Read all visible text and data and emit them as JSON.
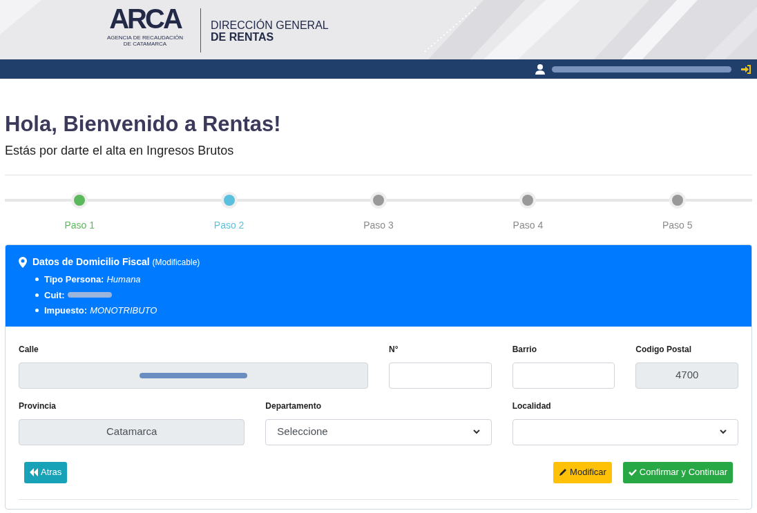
{
  "banner": {
    "logo": "ARCA",
    "agency_lines": [
      "AGENCIA DE RECAUDACIÓN",
      "DE CATAMARCA"
    ],
    "title_lines": [
      "DIRECCIÓN GENERAL",
      "DE RENTAS"
    ]
  },
  "user_bar": {
    "user_redacted": true
  },
  "heading": "Hola, Bienvenido a Rentas!",
  "subheading": "Estás por darte el alta en Ingresos Brutos",
  "steps": [
    {
      "label": "Paso 1",
      "completed": true,
      "selected": false
    },
    {
      "label": "Paso 2",
      "completed": false,
      "selected": true
    },
    {
      "label": "Paso 3",
      "completed": false,
      "selected": false
    },
    {
      "label": "Paso 4",
      "completed": false,
      "selected": false
    },
    {
      "label": "Paso 5",
      "completed": false,
      "selected": false
    }
  ],
  "card": {
    "title": "Datos de Domicilio Fiscal",
    "note": "(Modificable)",
    "facts": [
      {
        "label": "Tipo Persona:",
        "value": "Humana"
      },
      {
        "label": "Cuit:",
        "redacted": true
      },
      {
        "label": "Impuesto:",
        "value": "MONOTRIBUTO"
      }
    ]
  },
  "fields": [
    {
      "label": "Calle",
      "kind": "text",
      "disabled": true,
      "redacted": true
    },
    {
      "label": "N°",
      "kind": "text",
      "disabled": false
    },
    {
      "label": "Barrio",
      "kind": "text",
      "disabled": false
    },
    {
      "label": "Codigo Postal",
      "kind": "text",
      "disabled": true,
      "value": "4700"
    },
    {
      "label": "Provincia",
      "kind": "text",
      "disabled": true,
      "value": "Catamarca"
    },
    {
      "label": "Departamento",
      "kind": "select",
      "disabled": false,
      "value": "Seleccione"
    },
    {
      "label": "Localidad",
      "kind": "select",
      "disabled": false
    }
  ],
  "buttons": [
    {
      "label": "Atras",
      "kind": "back"
    },
    {
      "label": "Modificar",
      "kind": "edit"
    },
    {
      "label": "Confirmar y Continuar",
      "kind": "confirm"
    }
  ]
}
